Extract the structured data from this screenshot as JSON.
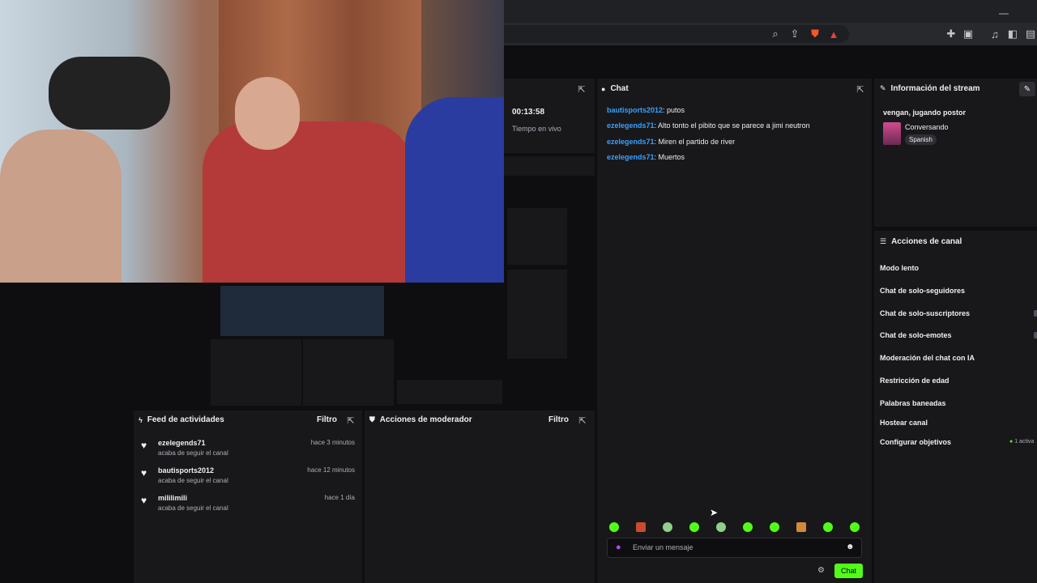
{
  "stream": {
    "timer": "00:13:58",
    "timer_label": "Tiempo en vivo"
  },
  "chat": {
    "title": "Chat",
    "messages": [
      {
        "user": "bautisports2012",
        "text": ": putos"
      },
      {
        "user": "ezelegends71",
        "text": ": Alto tonto el pibito que se parece a jimi neutron"
      },
      {
        "user": "ezelegends71",
        "text": ": Miren el partido de river"
      },
      {
        "user": "ezelegends71",
        "text": ": Muertos"
      }
    ],
    "input_placeholder": "Enviar un mensaje",
    "send_label": "Chat"
  },
  "stream_info": {
    "title": "Información del stream",
    "stream_title": "vengan, jugando postor",
    "category": "Conversando",
    "tag": "Spanish"
  },
  "channel_actions": {
    "title": "Acciones de canal",
    "items": [
      "Modo lento",
      "Chat de solo-seguidores",
      "Chat de solo-suscriptores",
      "Chat de solo-emotes",
      "Moderación del chat con IA",
      "Restricción de edad",
      "Palabras baneadas",
      "Hostear canal",
      "Configurar objetivos"
    ],
    "goals_status": "1 activa"
  },
  "activity_feed": {
    "title": "Feed de actividades",
    "filter_label": "Filtro",
    "events": [
      {
        "user": "ezelegends71",
        "action": "acaba de seguir el canal",
        "time": "hace 3 minutos"
      },
      {
        "user": "bautisports2012",
        "action": "acaba de seguir el canal",
        "time": "hace 12 minutos"
      },
      {
        "user": "mililimili",
        "action": "acaba de seguir el canal",
        "time": "hace 1 día"
      }
    ]
  },
  "moderator_actions": {
    "title": "Acciones de moderador",
    "filter_label": "Filtro"
  },
  "colors": {
    "accent": "#53fc18",
    "link": "#3aa0ff",
    "panel": "#18181b",
    "background": "#0e0e10"
  }
}
